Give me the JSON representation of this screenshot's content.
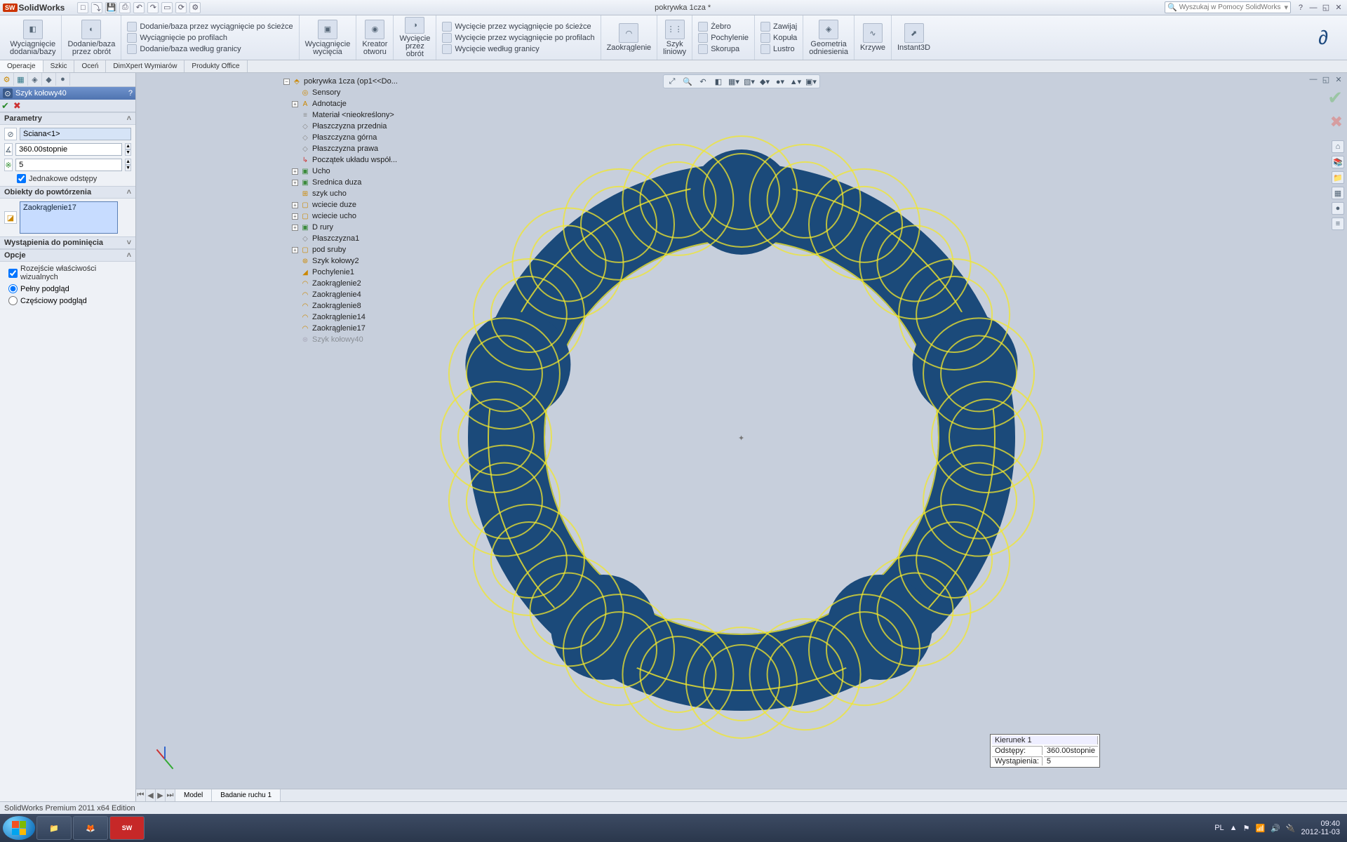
{
  "app": {
    "name": "SolidWorks",
    "doc_title": "pokrywka 1cza *",
    "search_placeholder": "Wyszukaj w Pomocy SolidWorks"
  },
  "ribbon": {
    "big": [
      {
        "label1": "Wyciągnięcie",
        "label2": "dodania/bazy"
      },
      {
        "label1": "Dodanie/baza",
        "label2": "przez obrót"
      }
    ],
    "list1": [
      "Dodanie/baza przez wyciągnięcie po ścieżce",
      "Wyciągnięcie po profilach",
      "Dodanie/baza według granicy"
    ],
    "big2": [
      {
        "label1": "Wyciągnięcie",
        "label2": "wycięcia"
      },
      {
        "label1": "Kreator",
        "label2": "otworu"
      },
      {
        "label1": "Wycięcie",
        "label2": "przez",
        "label3": "obrót"
      }
    ],
    "list2": [
      "Wycięcie przez wyciągnięcie po ścieżce",
      "Wycięcie przez wyciągnięcie po profilach",
      "Wycięcie według granicy"
    ],
    "big3": [
      {
        "label1": "Zaokrąglenie"
      },
      {
        "label1": "Szyk",
        "label2": "liniowy"
      }
    ],
    "list3": [
      "Żebro",
      "Pochylenie",
      "Skorupa"
    ],
    "list4": [
      "Zawijaj",
      "Kopuła",
      "Lustro"
    ],
    "big4": [
      {
        "label1": "Geometria",
        "label2": "odniesienia"
      },
      {
        "label1": "Krzywe"
      },
      {
        "label1": "Instant3D"
      }
    ]
  },
  "cmdtabs": [
    "Operacje",
    "Szkic",
    "Oceń",
    "DimXpert Wymiarów",
    "Produkty Office"
  ],
  "panel": {
    "title": "Szyk kołowy40",
    "sect_param": "Parametry",
    "axis_value": "Ściana<1>",
    "angle_value": "360.00stopnie",
    "count_value": "5",
    "equal_spacing": "Jednakowe odstępy",
    "sect_feat": "Obiekty do powtórzenia",
    "feat_value": "Zaokrąglenie17",
    "sect_skip": "Wystąpienia do pominięcia",
    "sect_opts": "Opcje",
    "opt_propagate": "Rozejście właściwości wizualnych",
    "opt_full": "Pełny podgląd",
    "opt_partial": "Częściowy podgląd"
  },
  "tree": {
    "root": "pokrywka 1cza  (op1<<Do...",
    "items": [
      "Sensory",
      "Adnotacje",
      "Materiał <nieokreślony>",
      "Płaszczyzna przednia",
      "Płaszczyzna górna",
      "Płaszczyzna prawa",
      "Początek układu współ...",
      "Ucho",
      "Srednica duza",
      "szyk ucho",
      "wciecie duze",
      "wciecie ucho",
      "D rury",
      "Płaszczyzna1",
      "pod sruby",
      "Szyk kołowy2",
      "Pochylenie1",
      "Zaokrąglenie2",
      "Zaokrąglenie4",
      "Zaokrąglenie8",
      "Zaokrąglenie14",
      "Zaokrąglenie17",
      "Szyk kołowy40"
    ]
  },
  "dirbox": {
    "h": "Kierunek 1",
    "r1k": "Odstępy:",
    "r1v": "360.00stopnie",
    "r2k": "Wystąpienia:",
    "r2v": "5"
  },
  "viewtabs": {
    "model": "Model",
    "motion": "Badanie ruchu 1"
  },
  "status": "SolidWorks Premium 2011 x64 Edition",
  "taskbar": {
    "lang": "PL",
    "time": "09:40",
    "date": "2012-11-03"
  }
}
